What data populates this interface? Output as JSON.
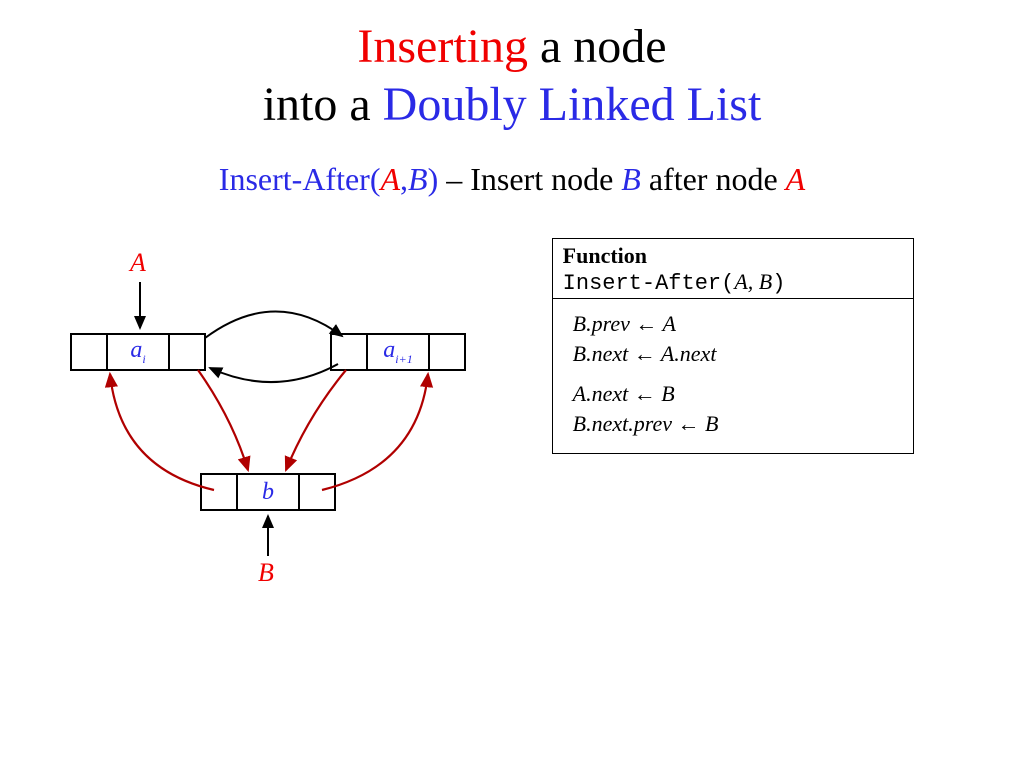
{
  "colors": {
    "red": "#f00000",
    "blue": "#2a2ae6",
    "darkred": "#b00000"
  },
  "title": {
    "line1_part1": "Inserting",
    "line1_part2": " a node",
    "line2_part1": "into a ",
    "line2_part2": "Doubly Linked List"
  },
  "subtitle": {
    "call": "Insert-After(",
    "argA": "A",
    "comma": ",",
    "argB": "B",
    "close": ")",
    "desc1": " – Insert node ",
    "descB": "B",
    "desc2": " after node ",
    "descA": "A"
  },
  "nodes": {
    "left_label": "a",
    "left_sub": "i",
    "right_label": "a",
    "right_sub": "i+1",
    "bottom_label": "b"
  },
  "labels": {
    "A": "A",
    "B": "B"
  },
  "code": {
    "head_fn": "Function",
    "head_call": "Insert-After(",
    "head_A": "A",
    "head_comma": ", ",
    "head_B": "B",
    "head_close": ")",
    "l1": "B.prev ← A",
    "l2": "B.next ← A.next",
    "l3": "A.next ← B",
    "l4": "B.next.prev ← B"
  }
}
